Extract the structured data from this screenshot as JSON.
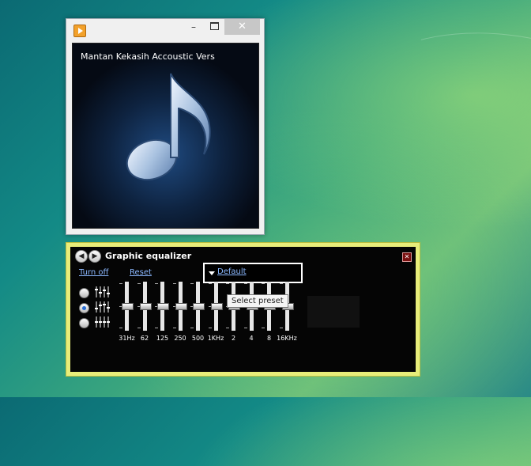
{
  "player": {
    "app_icon": "media-player-icon",
    "controls": {
      "minimize": "–",
      "close": "✕"
    },
    "track_title": "Mantan Kekasih Accoustic Vers",
    "artwork_icon": "music-note-icon"
  },
  "equalizer": {
    "title": "Graphic equalizer",
    "close_glyph": "✕",
    "prev_glyph": "◀",
    "next_glyph": "▶",
    "turn_off_label": "Turn off",
    "reset_label": "Reset",
    "preset_value": "Default",
    "preset_tooltip": "Select preset",
    "modes": [
      {
        "icon": "sliders-independent-icon",
        "selected": false
      },
      {
        "icon": "sliders-curve-icon",
        "selected": true
      },
      {
        "icon": "sliders-flat-icon",
        "selected": false
      }
    ],
    "bands": [
      {
        "label": "31Hz",
        "level": 0
      },
      {
        "label": "62",
        "level": 0
      },
      {
        "label": "125",
        "level": 0
      },
      {
        "label": "250",
        "level": 0
      },
      {
        "label": "500",
        "level": 0
      },
      {
        "label": "1KHz",
        "level": 0
      },
      {
        "label": "2",
        "level": 0
      },
      {
        "label": "4",
        "level": 0
      },
      {
        "label": "8",
        "level": 0
      },
      {
        "label": "16KHz",
        "level": 0
      }
    ]
  },
  "colors": {
    "eq_frame": "#e8ed7a",
    "link": "#8bb8ff",
    "eq_background": "#050505"
  }
}
